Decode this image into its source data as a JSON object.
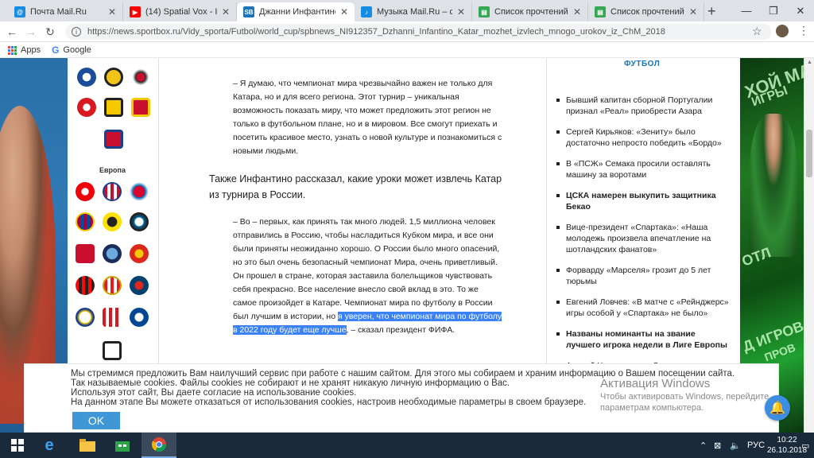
{
  "tabs": [
    {
      "title": "Почта Mail.Ru",
      "icon": "mail-icon",
      "color": "#168de2"
    },
    {
      "title": "(14) Spatial Vox - Inc",
      "icon": "youtube-icon",
      "color": "#ff0000"
    },
    {
      "title": "Джанни Инфантино: «К",
      "icon": "sportbox-icon",
      "color": "#1b74b8",
      "active": true
    },
    {
      "title": "Музыка Mail.Ru – слуша",
      "icon": "music-icon",
      "color": "#168de2"
    },
    {
      "title": "Список прочтений авто",
      "icon": "sheet-icon",
      "color": "#34a853"
    },
    {
      "title": "Список прочтений авто",
      "icon": "sheet-icon",
      "color": "#34a853"
    }
  ],
  "browser": {
    "url": "https://news.sportbox.ru/Vidy_sporta/Futbol/world_cup/spbnews_NI912357_Dzhanni_Infantino_Katar_mozhet_izvlech_mnogo_urokov_iz_ChM_2018",
    "bookmarks": [
      "Apps",
      "Google"
    ]
  },
  "sidebar": {
    "section_label": "Европа"
  },
  "article": {
    "quote1": "– Я думаю, что чемпионат мира чрезвычайно важен не только для Катара, но и для всего региона. Этот турнир – уникальная возможность показать миру, что может предложить этот регион не только в футбольном плане, но и в мировом. Все смогут приехать и посетить красивое место, узнать о новой культуре и познакомиться с новыми людьми.",
    "lead": "Также Инфантино рассказал, какие уроки может извлечь Катар из турнира в России.",
    "quote2_start": "– Во – первых, как принять так много людей. 1,5 миллиона человек отправились в Россию, чтобы насладиться Кубком мира, и все они были приняты неожиданно хорошо. О России было много опасений, но это был очень безопасный чемпионат Мира, очень приветливый. Он прошел в стране, которая заставила болельщиков чувствовать себя прекрасно. Все население внесло свой вклад в это. То же самое произойдет в Катаре. Чемпионат мира по футболу в России был лучшим в истории, но ",
    "quote2_highlight": "я уверен, что чемпионат мира по футболу в 2022 году будет еще лучше",
    "quote2_end": ", – сказал президент ФИФА."
  },
  "right": {
    "header": "ФУТБОЛ",
    "news": [
      {
        "text": "Бывший капитан сборной Португалии признал «Реал» приобрести Азара",
        "bold": false
      },
      {
        "text": "Сергей Кирьяков: «Зениту» было достаточно непросто победить «Бордо»",
        "bold": false
      },
      {
        "text": "В «ПСЖ» Семака просили оставлять машину за воротами",
        "bold": false
      },
      {
        "text": "ЦСКА намерен выкупить защитника Бекао",
        "bold": true
      },
      {
        "text": "Вице-президент «Спартака»: «Наша молодежь произвела впечатление на шотландских фанатов»",
        "bold": false
      },
      {
        "text": "Форварду «Марселя» грозит до 5 лет тюрьмы",
        "bold": false
      },
      {
        "text": "Евгений Ловчев: «В матче с «Рейнджерс» игры особой у «Спартака» не было»",
        "bold": false
      },
      {
        "text": "Названы номинанты на звание лучшего игрока недели в Лиге Европы",
        "bold": true
      },
      {
        "text": "Андрей Червиченко: «Спартак» мне",
        "bold": false
      }
    ]
  },
  "cookie": {
    "line1": "Мы стремимся предложить Вам наилучший сервис при работе с нашим сайтом. Для этого мы собираем и храним информацию о Вашем посещении сайта.",
    "line2": "Так называемые cookies. Файлы cookies не собирают и не хранят никакую личную информацию о Вас.",
    "line3": "Используя этот сайт, Вы даете согласие на использование cookies.",
    "line4": "На данном этапе Вы можете отказаться от использования cookies, настроив необходимые параметры в своем браузере.",
    "ok_label": "OK"
  },
  "activation": {
    "title": "Активация Windows",
    "line1": "Чтобы активировать Windows, перейдите",
    "line2": "параметрам компьютера."
  },
  "taskbar": {
    "lang": "РУС",
    "time": "10:22",
    "date": "26.10.2018"
  }
}
